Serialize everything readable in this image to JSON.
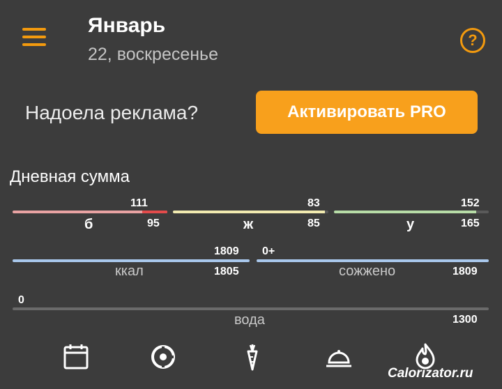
{
  "header": {
    "title": "Январь",
    "subtitle": "22, воскресенье",
    "help_symbol": "?"
  },
  "ad": {
    "text": "Надоела реклама?",
    "button_label": "Активировать PRO"
  },
  "daily": {
    "title": "Дневная сумма",
    "macros": [
      {
        "key": "b",
        "label": "б",
        "consumed": "111",
        "target": "95",
        "progress": 1.0,
        "over_fraction": 0.16,
        "color": "#e9a3a3"
      },
      {
        "key": "zh",
        "label": "ж",
        "consumed": "83",
        "target": "85",
        "progress": 0.976,
        "color": "#f2ebb0"
      },
      {
        "key": "u",
        "label": "у",
        "consumed": "152",
        "target": "165",
        "progress": 0.92,
        "color": "#b7dca7"
      }
    ],
    "kcal": {
      "label": "ккал",
      "consumed": "1809",
      "target": "1805",
      "progress": 1.0,
      "color": "#a9c8ec"
    },
    "burned": {
      "label": "сожжено",
      "value": "0+",
      "target": "1809",
      "progress": 1.0,
      "color": "#a9c8ec"
    },
    "water": {
      "label": "вода",
      "value": "0",
      "target": "1300",
      "progress": 0.0,
      "color": "#8a8a8a"
    }
  },
  "nav": {
    "items": [
      "calendar-icon",
      "pie-chart-icon",
      "carrot-icon",
      "meal-cloche-icon",
      "flame-drop-icon"
    ]
  },
  "brand": "Calorizator.ru",
  "colors": {
    "accent": "#f39a0e",
    "button": "#f8a01c",
    "background": "#3c3c3c",
    "over": "#e34b4b"
  }
}
